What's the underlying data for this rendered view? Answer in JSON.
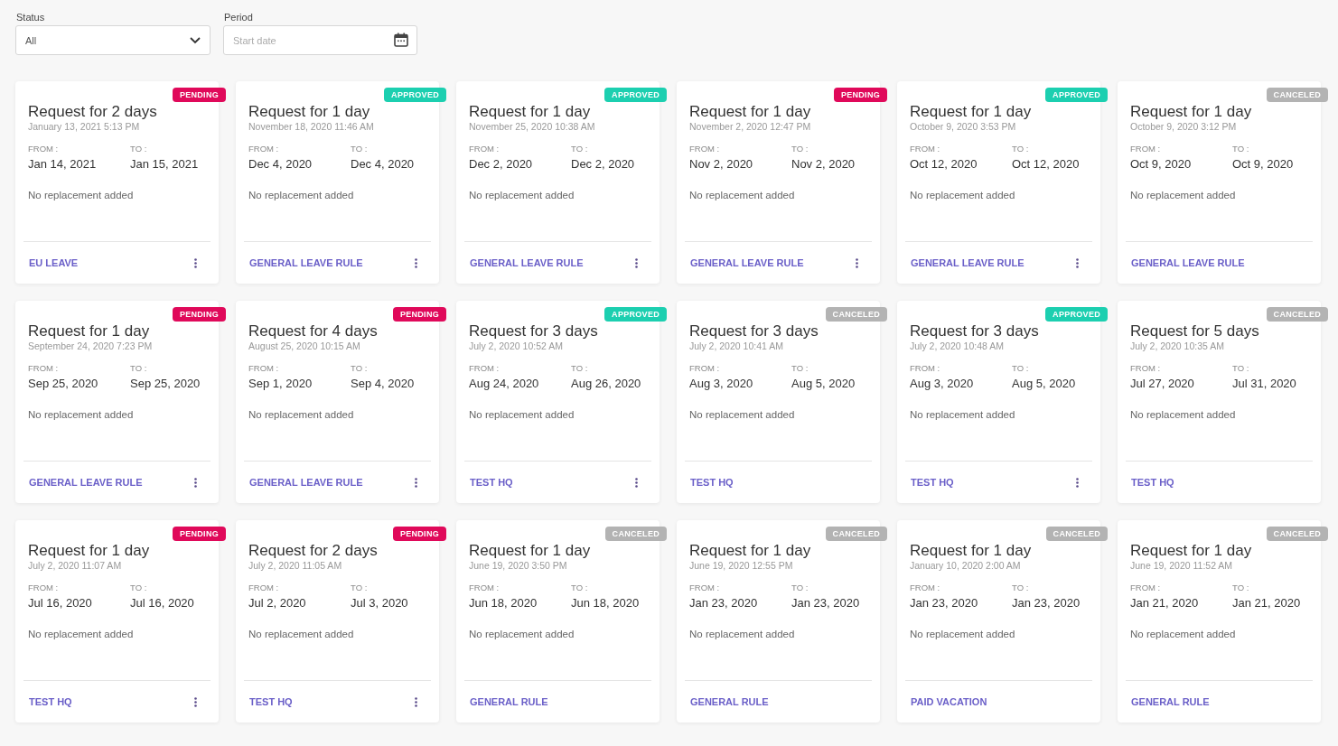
{
  "filters": {
    "status": {
      "label": "Status",
      "value": "All"
    },
    "period": {
      "label": "Period",
      "placeholder": "Start date"
    }
  },
  "requests": [
    {
      "status": "PENDING",
      "kind": "pending",
      "title": "Request for 2 days",
      "created": "January 13, 2021 5:13 PM",
      "from_label": "FROM :",
      "from": "Jan 14, 2021",
      "to_label": "TO :",
      "to": "Jan 15, 2021",
      "replacement": "No replacement added",
      "rule": "EU LEAVE",
      "has_menu": true
    },
    {
      "status": "APPROVED",
      "kind": "approved",
      "title": "Request for 1 day",
      "created": "November 18, 2020 11:46 AM",
      "from_label": "FROM :",
      "from": "Dec 4, 2020",
      "to_label": "TO :",
      "to": "Dec 4, 2020",
      "replacement": "No replacement added",
      "rule": "GENERAL LEAVE RULE",
      "has_menu": true
    },
    {
      "status": "APPROVED",
      "kind": "approved",
      "title": "Request for 1 day",
      "created": "November 25, 2020 10:38 AM",
      "from_label": "FROM :",
      "from": "Dec 2, 2020",
      "to_label": "TO :",
      "to": "Dec 2, 2020",
      "replacement": "No replacement added",
      "rule": "GENERAL LEAVE RULE",
      "has_menu": true
    },
    {
      "status": "PENDING",
      "kind": "pending",
      "title": "Request for 1 day",
      "created": "November 2, 2020 12:47 PM",
      "from_label": "FROM :",
      "from": "Nov 2, 2020",
      "to_label": "TO :",
      "to": "Nov 2, 2020",
      "replacement": "No replacement added",
      "rule": "GENERAL LEAVE RULE",
      "has_menu": true
    },
    {
      "status": "APPROVED",
      "kind": "approved",
      "title": "Request for 1 day",
      "created": "October 9, 2020 3:53 PM",
      "from_label": "FROM :",
      "from": "Oct 12, 2020",
      "to_label": "TO :",
      "to": "Oct 12, 2020",
      "replacement": "No replacement added",
      "rule": "GENERAL LEAVE RULE",
      "has_menu": true
    },
    {
      "status": "CANCELED",
      "kind": "canceled",
      "title": "Request for 1 day",
      "created": "October 9, 2020 3:12 PM",
      "from_label": "FROM :",
      "from": "Oct 9, 2020",
      "to_label": "TO :",
      "to": "Oct 9, 2020",
      "replacement": "No replacement added",
      "rule": "GENERAL LEAVE RULE",
      "has_menu": false
    },
    {
      "status": "PENDING",
      "kind": "pending",
      "title": "Request for 1 day",
      "created": "September 24, 2020 7:23 PM",
      "from_label": "FROM :",
      "from": "Sep 25, 2020",
      "to_label": "TO :",
      "to": "Sep 25, 2020",
      "replacement": "No replacement added",
      "rule": "GENERAL LEAVE RULE",
      "has_menu": true
    },
    {
      "status": "PENDING",
      "kind": "pending",
      "title": "Request for 4 days",
      "created": "August 25, 2020 10:15 AM",
      "from_label": "FROM :",
      "from": "Sep 1, 2020",
      "to_label": "TO :",
      "to": "Sep 4, 2020",
      "replacement": "No replacement added",
      "rule": "GENERAL LEAVE RULE",
      "has_menu": true
    },
    {
      "status": "APPROVED",
      "kind": "approved",
      "title": "Request for 3 days",
      "created": "July 2, 2020 10:52 AM",
      "from_label": "FROM :",
      "from": "Aug 24, 2020",
      "to_label": "TO :",
      "to": "Aug 26, 2020",
      "replacement": "No replacement added",
      "rule": "TEST HQ",
      "has_menu": true
    },
    {
      "status": "CANCELED",
      "kind": "canceled",
      "title": "Request for 3 days",
      "created": "July 2, 2020 10:41 AM",
      "from_label": "FROM :",
      "from": "Aug 3, 2020",
      "to_label": "TO :",
      "to": "Aug 5, 2020",
      "replacement": "No replacement added",
      "rule": "TEST HQ",
      "has_menu": false
    },
    {
      "status": "APPROVED",
      "kind": "approved",
      "title": "Request for 3 days",
      "created": "July 2, 2020 10:48 AM",
      "from_label": "FROM :",
      "from": "Aug 3, 2020",
      "to_label": "TO :",
      "to": "Aug 5, 2020",
      "replacement": "No replacement added",
      "rule": "TEST HQ",
      "has_menu": true
    },
    {
      "status": "CANCELED",
      "kind": "canceled",
      "title": "Request for 5 days",
      "created": "July 2, 2020 10:35 AM",
      "from_label": "FROM :",
      "from": "Jul 27, 2020",
      "to_label": "TO :",
      "to": "Jul 31, 2020",
      "replacement": "No replacement added",
      "rule": "TEST HQ",
      "has_menu": false
    },
    {
      "status": "PENDING",
      "kind": "pending",
      "title": "Request for 1 day",
      "created": "July 2, 2020 11:07 AM",
      "from_label": "FROM :",
      "from": "Jul 16, 2020",
      "to_label": "TO :",
      "to": "Jul 16, 2020",
      "replacement": "No replacement added",
      "rule": "TEST HQ",
      "has_menu": true
    },
    {
      "status": "PENDING",
      "kind": "pending",
      "title": "Request for 2 days",
      "created": "July 2, 2020 11:05 AM",
      "from_label": "FROM :",
      "from": "Jul 2, 2020",
      "to_label": "TO :",
      "to": "Jul 3, 2020",
      "replacement": "No replacement added",
      "rule": "TEST HQ",
      "has_menu": true
    },
    {
      "status": "CANCELED",
      "kind": "canceled",
      "title": "Request for 1 day",
      "created": "June 19, 2020 3:50 PM",
      "from_label": "FROM :",
      "from": "Jun 18, 2020",
      "to_label": "TO :",
      "to": "Jun 18, 2020",
      "replacement": "No replacement added",
      "rule": "GENERAL RULE",
      "has_menu": false
    },
    {
      "status": "CANCELED",
      "kind": "canceled",
      "title": "Request for 1 day",
      "created": "June 19, 2020 12:55 PM",
      "from_label": "FROM :",
      "from": "Jan 23, 2020",
      "to_label": "TO :",
      "to": "Jan 23, 2020",
      "replacement": "No replacement added",
      "rule": "GENERAL RULE",
      "has_menu": false
    },
    {
      "status": "CANCELED",
      "kind": "canceled",
      "title": "Request for 1 day",
      "created": "January 10, 2020 2:00 AM",
      "from_label": "FROM :",
      "from": "Jan 23, 2020",
      "to_label": "TO :",
      "to": "Jan 23, 2020",
      "replacement": "No replacement added",
      "rule": "PAID VACATION",
      "has_menu": false
    },
    {
      "status": "CANCELED",
      "kind": "canceled",
      "title": "Request for 1 day",
      "created": "June 19, 2020 11:52 AM",
      "from_label": "FROM :",
      "from": "Jan 21, 2020",
      "to_label": "TO :",
      "to": "Jan 21, 2020",
      "replacement": "No replacement added",
      "rule": "GENERAL RULE",
      "has_menu": false
    }
  ]
}
